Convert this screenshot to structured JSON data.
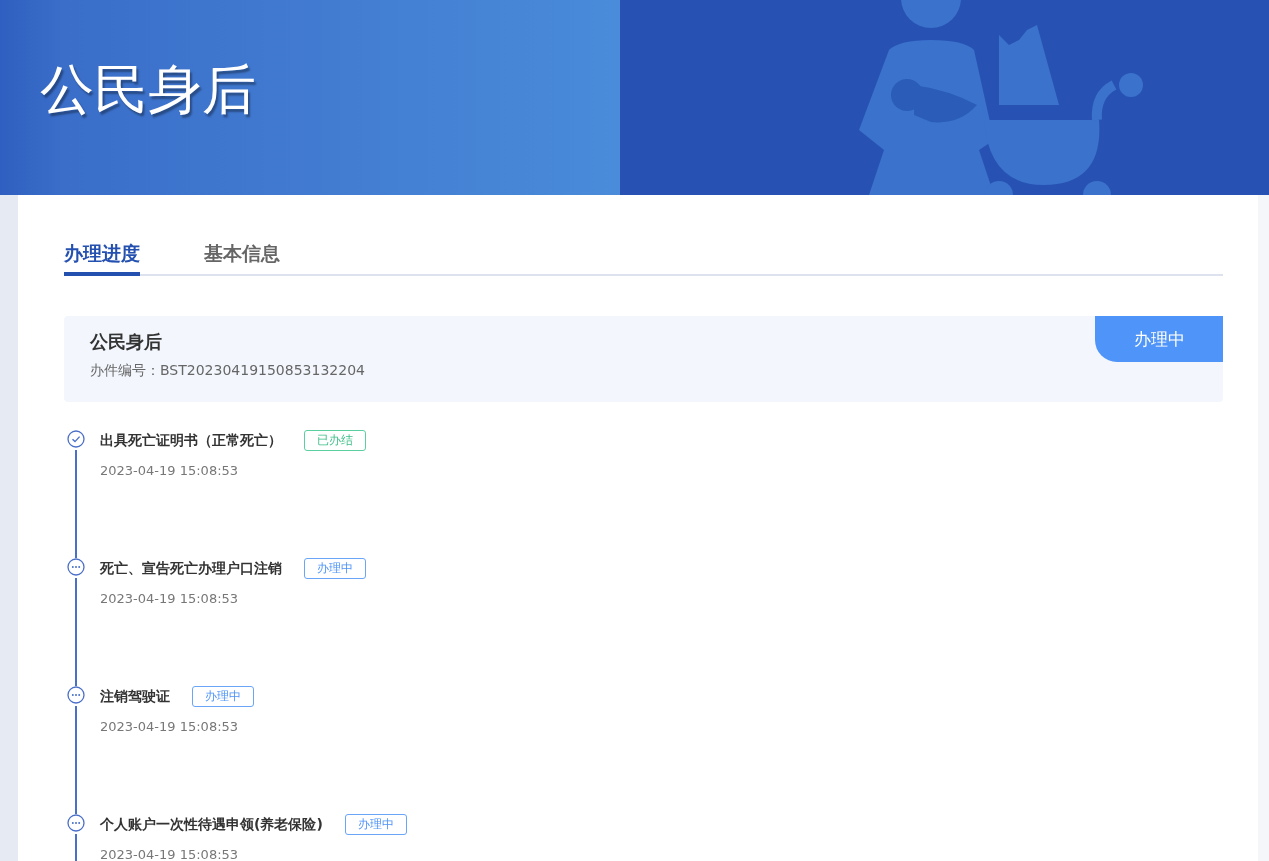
{
  "banner": {
    "title": "公民身后"
  },
  "tabs": [
    {
      "label": "办理进度",
      "selected": true
    },
    {
      "label": "基本信息",
      "selected": false
    }
  ],
  "case": {
    "title": "公民身后",
    "number": "办件编号：BST20230419150853132204",
    "status": "办理中"
  },
  "steps": [
    {
      "title": "出具死亡证明书（正常死亡）",
      "status": "已办结",
      "kind": "done",
      "time": "2023-04-19 15:08:53"
    },
    {
      "title": "死亡、宣告死亡办理户口注销",
      "status": "办理中",
      "kind": "progress",
      "time": "2023-04-19 15:08:53"
    },
    {
      "title": "注销驾驶证",
      "status": "办理中",
      "kind": "progress",
      "time": "2023-04-19 15:08:53"
    },
    {
      "title": "个人账户一次性待遇申领(养老保险)",
      "status": "办理中",
      "kind": "progress",
      "time": "2023-04-19 15:08:53"
    }
  ]
}
